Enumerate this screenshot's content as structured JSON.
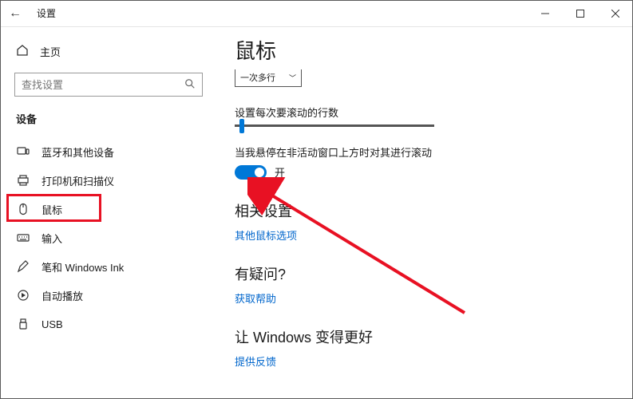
{
  "titlebar": {
    "back_icon": "←",
    "app_title": "设置"
  },
  "sidebar": {
    "home_label": "主页",
    "search_placeholder": "查找设置",
    "section_label": "设备",
    "items": [
      {
        "label": "蓝牙和其他设备"
      },
      {
        "label": "打印机和扫描仪"
      },
      {
        "label": "鼠标"
      },
      {
        "label": "输入"
      },
      {
        "label": "笔和 Windows Ink"
      },
      {
        "label": "自动播放"
      },
      {
        "label": "USB"
      }
    ]
  },
  "main": {
    "title": "鼠标",
    "dropdown_value": "一次多行",
    "scroll_lines_label": "设置每次要滚动的行数",
    "inactive_scroll_label": "当我悬停在非活动窗口上方时对其进行滚动",
    "toggle_on_label": "开",
    "related_header": "相关设置",
    "related_link": "其他鼠标选项",
    "help_header": "有疑问?",
    "help_link": "获取帮助",
    "better_header": "让 Windows 变得更好",
    "feedback_link": "提供反馈"
  },
  "colors": {
    "accent": "#0078d7",
    "link": "#0066cc",
    "highlight_box": "#e81123",
    "arrow": "#e81123"
  }
}
